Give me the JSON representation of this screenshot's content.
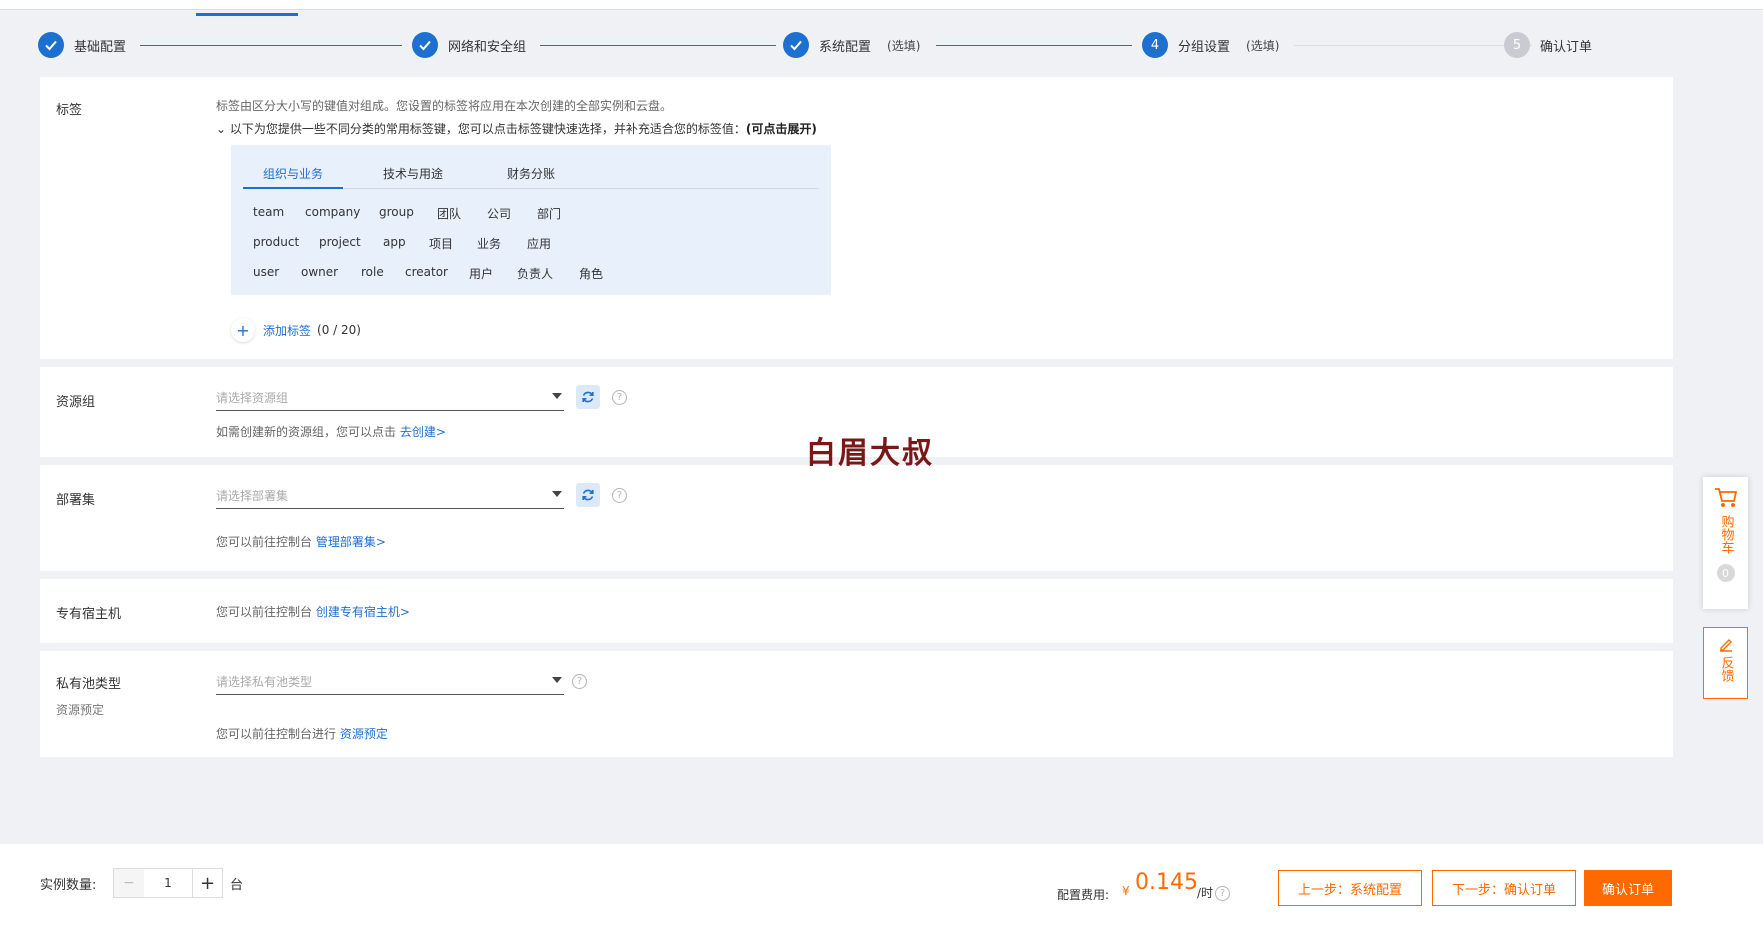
{
  "steps": [
    {
      "label": "基础配置",
      "state": "done"
    },
    {
      "label": "网络和安全组",
      "state": "done"
    },
    {
      "label": "系统配置",
      "optional": "(选填)",
      "state": "done"
    },
    {
      "number": "4",
      "label": "分组设置",
      "optional": "(选填)",
      "state": "active"
    },
    {
      "number": "5",
      "label": "确认订单",
      "state": "pending"
    }
  ],
  "tags": {
    "label": "标签",
    "hint": "标签由区分大小写的键值对组成。您设置的标签将应用在本次创建的全部实例和云盘。",
    "expand_hint": "以下为您提供一些不同分类的常用标签键，您可以点击标签键快速选择，并补充适合您的标签值：",
    "expand_hint_bold": "(可点击展开)",
    "tabs": [
      "组织与业务",
      "技术与用途",
      "财务分账"
    ],
    "rows": [
      [
        "team",
        "company",
        "group",
        "团队",
        "公司",
        "部门"
      ],
      [
        "product",
        "project",
        "app",
        "项目",
        "业务",
        "应用"
      ],
      [
        "user",
        "owner",
        "role",
        "creator",
        "用户",
        "负责人",
        "角色"
      ]
    ],
    "add_label": "添加标签",
    "add_count": "(0 / 20)"
  },
  "resource_group": {
    "label": "资源组",
    "placeholder": "请选择资源组",
    "hint": "如需创建新的资源组，您可以点击",
    "link": "去创建>"
  },
  "deployment_set": {
    "label": "部署集",
    "placeholder": "请选择部署集",
    "hint": "您可以前往控制台",
    "link": "管理部署集>"
  },
  "dedicated_host": {
    "label": "专有宿主机",
    "hint": "您可以前往控制台",
    "link": "创建专有宿主机>"
  },
  "private_pool": {
    "label": "私有池类型",
    "sub_label": "资源预定",
    "placeholder": "请选择私有池类型",
    "hint": "您可以前往控制台进行",
    "link": "资源预定"
  },
  "watermark": "白眉大叔",
  "side": {
    "cart_label": "购物车",
    "cart_count": "0",
    "feedback_label": "反馈"
  },
  "footer": {
    "qty_label": "实例数量:",
    "qty_minus": "−",
    "qty_value": "1",
    "qty_plus": "+",
    "qty_unit": "台",
    "fee_label": "配置费用:",
    "fee_currency": "¥",
    "fee_amount": "0.145",
    "fee_unit": "/时",
    "btn_prev": "上一步：系统配置",
    "btn_next": "下一步：确认订单",
    "btn_confirm": "确认订单"
  },
  "colors": {
    "primary": "#1d6fd0",
    "accent": "#ff6a00"
  }
}
